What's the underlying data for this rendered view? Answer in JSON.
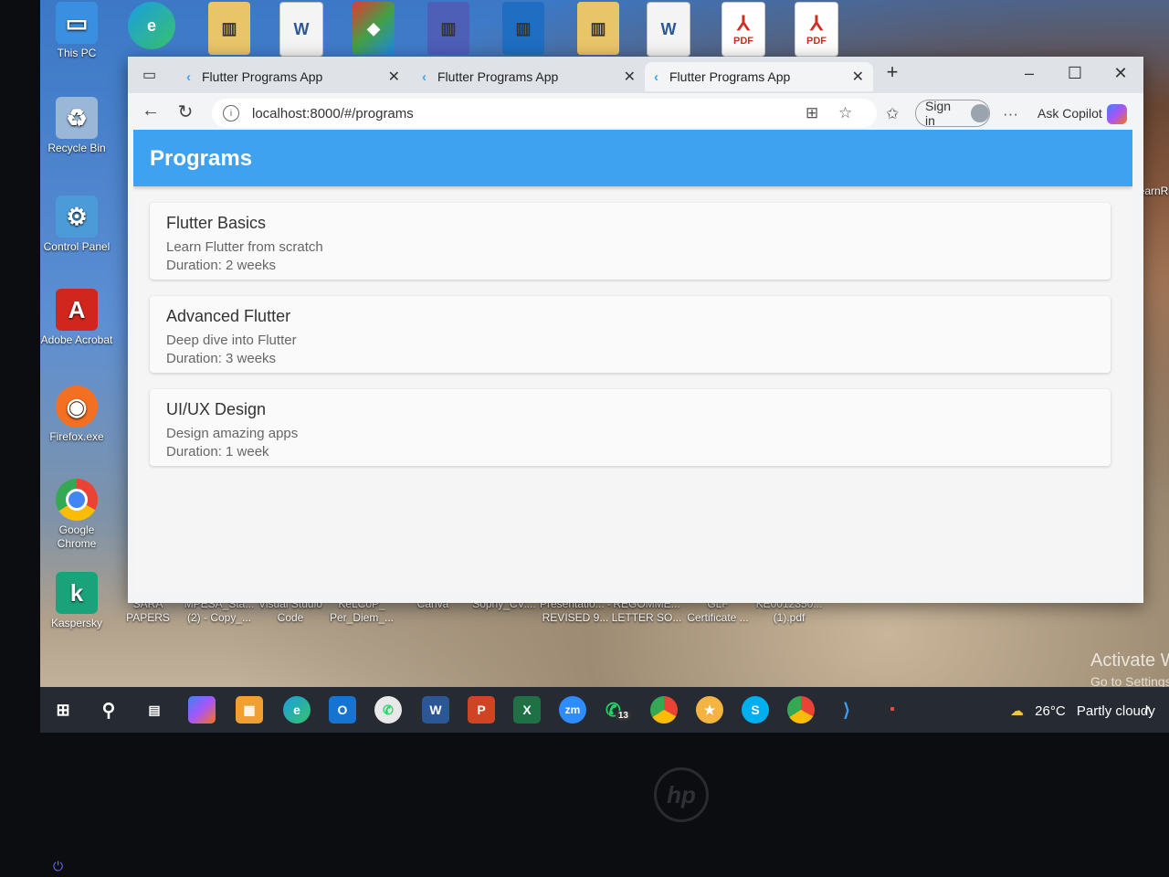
{
  "desktop": {
    "left_icons": [
      {
        "label": "This PC",
        "icon": "pc-icon",
        "color": "#3b8fe0"
      },
      {
        "label": "Recycle Bin",
        "icon": "recycle-bin-icon",
        "color": "#9ab7d8"
      },
      {
        "label": "Control Panel",
        "icon": "control-panel-icon",
        "color": "#4b9bd8"
      },
      {
        "label": "Adobe Acrobat",
        "icon": "acrobat-icon",
        "color": "#d1261d"
      },
      {
        "label": "Firefox.exe",
        "icon": "firefox-icon",
        "color": "#f36f21"
      },
      {
        "label": "Google Chrome",
        "icon": "chrome-icon",
        "color": "#4caf50"
      },
      {
        "label": "Kaspersky",
        "icon": "kaspersky-icon",
        "color": "#1aa37a"
      }
    ],
    "right_label": "learnR",
    "bottom_icons": [
      "SARA PAPERS",
      "MPESA_Sta... (2) - Copy_...",
      "Visual Studio Code",
      "KeLCoP_ Per_Diem_...",
      "Canva",
      "Sophy_CV....",
      "Presentatio... - REVISED 9...",
      "REGOMME... LETTER SO...",
      "GLF Certificate ...",
      "KE0012350... (1).pdf"
    ],
    "top_pdf_label": "PDF",
    "activate_title": "Activate Wind",
    "activate_sub": "Go to Settings to a"
  },
  "browser": {
    "tabs": [
      {
        "label": "Flutter Programs App",
        "active": false
      },
      {
        "label": "Flutter Programs App",
        "active": false
      },
      {
        "label": "Flutter Programs App",
        "active": true
      }
    ],
    "url": "localhost:8000/#/programs",
    "sign_in_label": "Sign in",
    "copilot_label": "Ask Copilot",
    "more_label": "···"
  },
  "app": {
    "title": "Programs",
    "programs": [
      {
        "title": "Flutter Basics",
        "subtitle": "Learn Flutter from scratch",
        "duration": "Duration: 2 weeks"
      },
      {
        "title": "Advanced Flutter",
        "subtitle": "Deep dive into Flutter",
        "duration": "Duration: 3 weeks"
      },
      {
        "title": "UI/UX Design",
        "subtitle": "Design amazing apps",
        "duration": "Duration: 1 week"
      }
    ]
  },
  "taskbar": {
    "weather_temp": "26°C",
    "weather_desc": "Partly cloudy",
    "whatsapp_badge": "13",
    "zoom_label": "zm"
  },
  "colors": {
    "appbar": "#3ea2f0",
    "taskbar": "#252a33",
    "card": "#fafafa"
  }
}
